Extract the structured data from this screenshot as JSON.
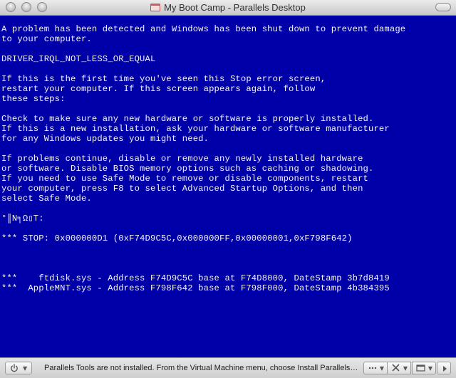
{
  "window": {
    "title": "My Boot Camp - Parallels Desktop"
  },
  "bsod": {
    "lines": [
      "A problem has been detected and Windows has been shut down to prevent damage",
      "to your computer.",
      "",
      "DRIVER_IRQL_NOT_LESS_OR_EQUAL",
      "",
      "If this is the first time you've seen this Stop error screen,",
      "restart your computer. If this screen appears again, follow",
      "these steps:",
      "",
      "Check to make sure any new hardware or software is properly installed.",
      "If this is a new installation, ask your hardware or software manufacturer",
      "for any Windows updates you might need.",
      "",
      "If problems continue, disable or remove any newly installed hardware",
      "or software. Disable BIOS memory options such as caching or shadowing.",
      "If you need to use Safe Mode to remove or disable components, restart",
      "your computer, press F8 to select Advanced Startup Options, and then",
      "select Safe Mode.",
      "",
      "°║N╕Ω▯T:",
      "",
      "*** STOP: 0x000000D1 (0xF74D9C5C,0x000000FF,0x00000001,0xF798F642)",
      "",
      "",
      "",
      "***    ftdisk.sys - Address F74D9C5C base at F74D8000, DateStamp 3b7d8419",
      "***  AppleMNT.sys - Address F798F642 base at F798F000, DateStamp 4b384395"
    ]
  },
  "statusbar": {
    "message": "Parallels Tools are not installed. From the Virtual Machine menu, choose Install Parallels Tools"
  },
  "icons": {
    "close": "close-icon",
    "minimize": "minimize-icon",
    "zoom": "zoom-icon",
    "vm": "vm-window-icon",
    "power": "power-icon",
    "devices": "devices-icon",
    "tools": "tools-icon",
    "window_mode": "window-mode-icon",
    "arrow": "arrow-icon"
  },
  "colors": {
    "bsod_background": "#0000a8",
    "bsod_text": "#f4f4f4"
  }
}
